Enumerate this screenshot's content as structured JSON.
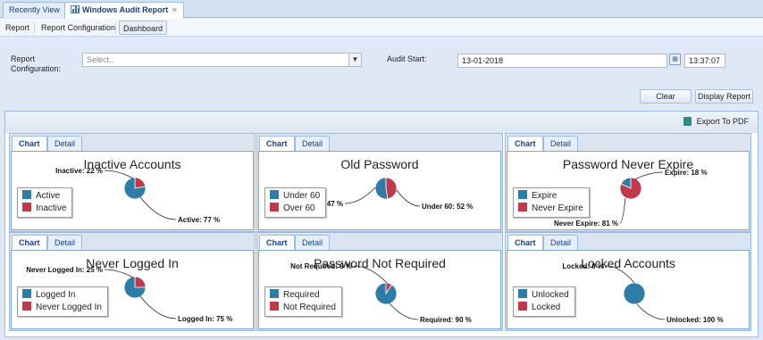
{
  "tabs": [
    {
      "label": "Recently View"
    },
    {
      "label": "Windows Audit Report",
      "close": "✕"
    }
  ],
  "menu": [
    "Report",
    "Report Configuration",
    "Dashboard"
  ],
  "form": {
    "report_config_label": "Report Configuration:",
    "report_config_placeholder": "Select..",
    "audit_start_label": "Audit Start:",
    "audit_date": "13-01-2018",
    "audit_time": "13:37:07",
    "clear_label": "Clear",
    "display_label": "Display Report"
  },
  "export_label": "Export To PDF",
  "card_tabs": {
    "chart": "Chart",
    "detail": "Detail"
  },
  "colors": {
    "primary": "#2e7ca8",
    "secondary": "#c0394b"
  },
  "charts": [
    {
      "title": "Inactive Accounts",
      "legend": [
        "Active",
        "Inactive"
      ],
      "values": [
        77,
        22
      ],
      "labels": [
        "Active: 77 %",
        "Inactive: 22 %"
      ]
    },
    {
      "title": "Old Password",
      "legend": [
        "Under 60",
        "Over 60"
      ],
      "values": [
        52,
        47
      ],
      "labels": [
        "Under 60: 52 %",
        "Over 60: 47 %"
      ]
    },
    {
      "title": "Password Never Expire",
      "legend": [
        "Expire",
        "Never Expire"
      ],
      "values": [
        18,
        81
      ],
      "labels": [
        "Expire: 18 %",
        "Never Expire: 81 %"
      ]
    },
    {
      "title": "Never Logged In",
      "legend": [
        "Logged In",
        "Never Logged In"
      ],
      "values": [
        75,
        25
      ],
      "labels": [
        "Logged In: 75 %",
        "Never Logged In: 25 %"
      ]
    },
    {
      "title": "Password Not Required",
      "legend": [
        "Required",
        "Not Required"
      ],
      "values": [
        90,
        9
      ],
      "labels": [
        "Required: 90 %",
        "Not Required: 9 %"
      ]
    },
    {
      "title": "Locked Accounts",
      "legend": [
        "Unlocked",
        "Locked"
      ],
      "values": [
        100,
        0
      ],
      "labels": [
        "Unlocked: 100 %",
        "Locked: 0 %"
      ]
    }
  ],
  "chart_data": [
    {
      "type": "pie",
      "title": "Inactive Accounts",
      "categories": [
        "Active",
        "Inactive"
      ],
      "values": [
        77,
        22
      ],
      "unit": "%",
      "legend": "left"
    },
    {
      "type": "pie",
      "title": "Old Password",
      "categories": [
        "Under 60",
        "Over 60"
      ],
      "values": [
        52,
        47
      ],
      "unit": "%",
      "legend": "left"
    },
    {
      "type": "pie",
      "title": "Password Never Expire",
      "categories": [
        "Expire",
        "Never Expire"
      ],
      "values": [
        18,
        81
      ],
      "unit": "%",
      "legend": "left"
    },
    {
      "type": "pie",
      "title": "Never Logged In",
      "categories": [
        "Logged In",
        "Never Logged In"
      ],
      "values": [
        75,
        25
      ],
      "unit": "%",
      "legend": "left"
    },
    {
      "type": "pie",
      "title": "Password Not Required",
      "categories": [
        "Required",
        "Not Required"
      ],
      "values": [
        90,
        9
      ],
      "unit": "%",
      "legend": "left"
    },
    {
      "type": "pie",
      "title": "Locked Accounts",
      "categories": [
        "Unlocked",
        "Locked"
      ],
      "values": [
        100,
        0
      ],
      "unit": "%",
      "legend": "left"
    }
  ]
}
